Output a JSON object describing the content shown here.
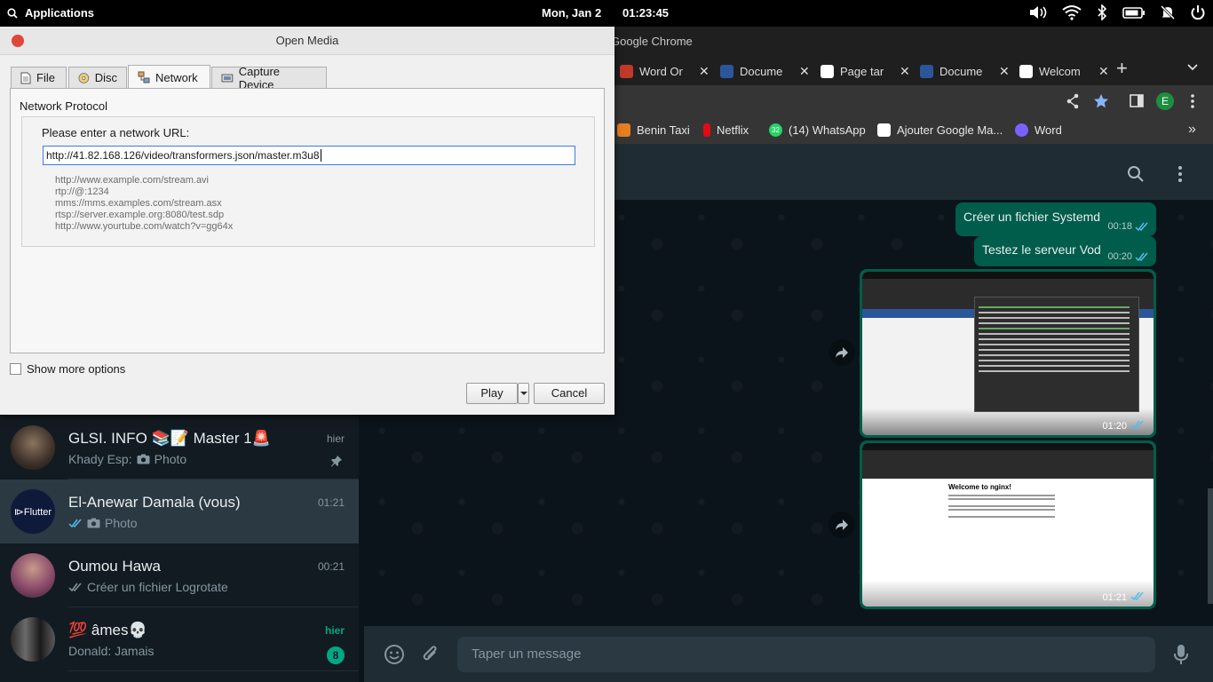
{
  "top_panel": {
    "apps_label": "Applications",
    "date": "Mon, Jan  2",
    "time": "01:23:45"
  },
  "chrome": {
    "window_title": "Google Chrome",
    "tabs": [
      {
        "label": "Word Or",
        "color": "#c0392b"
      },
      {
        "label": "Docume",
        "color": "#2b579a"
      },
      {
        "label": "Page tar",
        "color": "#ffffff"
      },
      {
        "label": "Docume",
        "color": "#2b579a"
      },
      {
        "label": "Welcom",
        "color": "#ffffff"
      }
    ],
    "profile_initial": "E",
    "bookmarks": [
      {
        "label": "Benin Taxi",
        "color": "#e67e22"
      },
      {
        "label": "Netflix",
        "color": "#e50914"
      },
      {
        "label": "(14) WhatsApp",
        "color": "#25d366",
        "badge": "32"
      },
      {
        "label": "Ajouter Google Ma...",
        "color": "#4285f4"
      },
      {
        "label": "Word",
        "color": "#7b61ff"
      }
    ]
  },
  "chats": [
    {
      "name": "GLSI. INFO 📚📝 Master 1🚨",
      "preview_sender": "Khady Esp:",
      "preview": "Photo",
      "time": "hier",
      "pinned": true
    },
    {
      "name": "El-Anewar Damala (vous)",
      "preview": "Photo",
      "time": "01:21",
      "active": true
    },
    {
      "name": "Oumou Hawa",
      "preview": "Créer un fichier Logrotate",
      "time": "00:21"
    },
    {
      "name": "💯 âmes💀",
      "preview": "Donald: Jamais",
      "time": "hier",
      "unread": "8"
    }
  ],
  "messages": [
    {
      "text": "Créer un fichier Systemd",
      "time": "00:18"
    },
    {
      "text": "Testez le serveur Vod",
      "time": "00:20"
    }
  ],
  "image_messages": [
    {
      "time": "01:20"
    },
    {
      "time": "01:21",
      "caption": "Welcome to nginx!"
    }
  ],
  "composer": {
    "placeholder": "Taper un message"
  },
  "dialog": {
    "title": "Open Media",
    "tabs": [
      "File",
      "Disc",
      "Network",
      "Capture Device"
    ],
    "active_tab": "Network",
    "group_title": "Network Protocol",
    "url_prompt": "Please enter a network URL:",
    "url_value": "http://41.82.168.126/video/transformers.json/master.m3u8",
    "examples": [
      "http://www.example.com/stream.avi",
      "rtp://@:1234",
      "mms://mms.examples.com/stream.asx",
      "rtsp://server.example.org:8080/test.sdp",
      "http://www.yourtube.com/watch?v=gg64x"
    ],
    "show_more": "Show more options",
    "play_label": "Play",
    "cancel_label": "Cancel"
  }
}
